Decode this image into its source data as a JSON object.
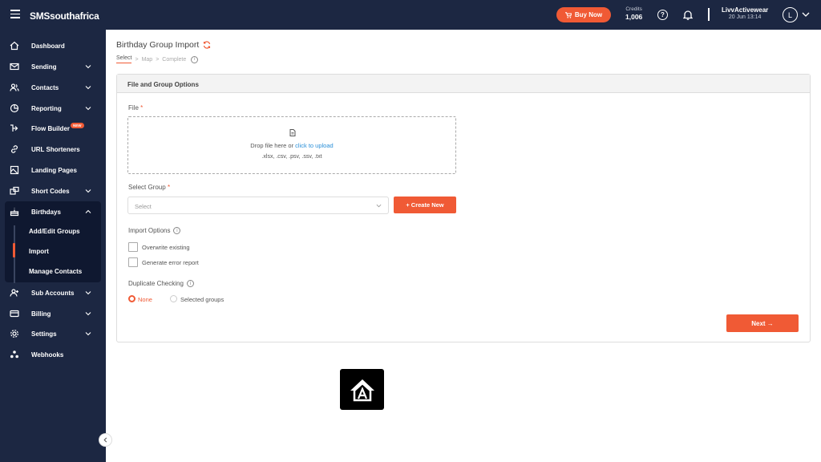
{
  "header": {
    "brand": "SMSsouthafrica",
    "buy_now": "Buy Now",
    "credits_label": "Credits",
    "credits_value": "1,006",
    "help_glyph": "?",
    "user_name": "LivvActivewear",
    "user_date": "20 Jun 13:14",
    "avatar_letter": "L"
  },
  "sidebar": {
    "items": [
      {
        "label": "Dashboard",
        "icon": "home-icon"
      },
      {
        "label": "Sending",
        "icon": "mail-icon",
        "expandable": true
      },
      {
        "label": "Contacts",
        "icon": "contacts-icon",
        "expandable": true
      },
      {
        "label": "Reporting",
        "icon": "report-icon",
        "expandable": true
      },
      {
        "label": "Flow Builder",
        "icon": "flow-icon",
        "badge": "NEW"
      },
      {
        "label": "URL Shorteners",
        "icon": "link-icon"
      },
      {
        "label": "Landing Pages",
        "icon": "landing-page-icon"
      },
      {
        "label": "Short Codes",
        "icon": "short-code-icon",
        "expandable": true
      },
      {
        "label": "Birthdays",
        "icon": "birthday-icon",
        "expanded": true
      },
      {
        "label": "Sub Accounts",
        "icon": "sub-accounts-icon",
        "expandable": true
      },
      {
        "label": "Billing",
        "icon": "billing-icon",
        "expandable": true
      },
      {
        "label": "Settings",
        "icon": "settings-icon",
        "expandable": true
      },
      {
        "label": "Webhooks",
        "icon": "webhooks-icon"
      }
    ],
    "birthday_sub": [
      "Add/Edit Groups",
      "Import",
      "Manage Contacts"
    ],
    "active_sub": "Import"
  },
  "page": {
    "title": "Birthday Group Import",
    "steps": [
      "Select",
      "Map",
      "Complete"
    ],
    "step_sep": ">",
    "active_step": "Select"
  },
  "card": {
    "header": "File and Group Options",
    "file_label": "File",
    "required_mark": "*",
    "drop_text": "Drop file here or ",
    "drop_link": "click to upload",
    "formats": ".xlsx, .csv, .psv, .ssv, .txt",
    "group_label": "Select Group",
    "select_placeholder": "Select",
    "create_new": "+ Create New",
    "import_options_label": "Import Options",
    "overwrite_label": "Overwrite existing",
    "error_report_label": "Generate error report",
    "dup_label": "Duplicate Checking",
    "dup_none": "None",
    "dup_selected": "Selected groups",
    "dup_value": "None",
    "info_glyph": "i",
    "next_label": "Next →"
  },
  "colors": {
    "navy": "#1c2742",
    "accent": "#f05a35",
    "link": "#2a8fd8"
  }
}
